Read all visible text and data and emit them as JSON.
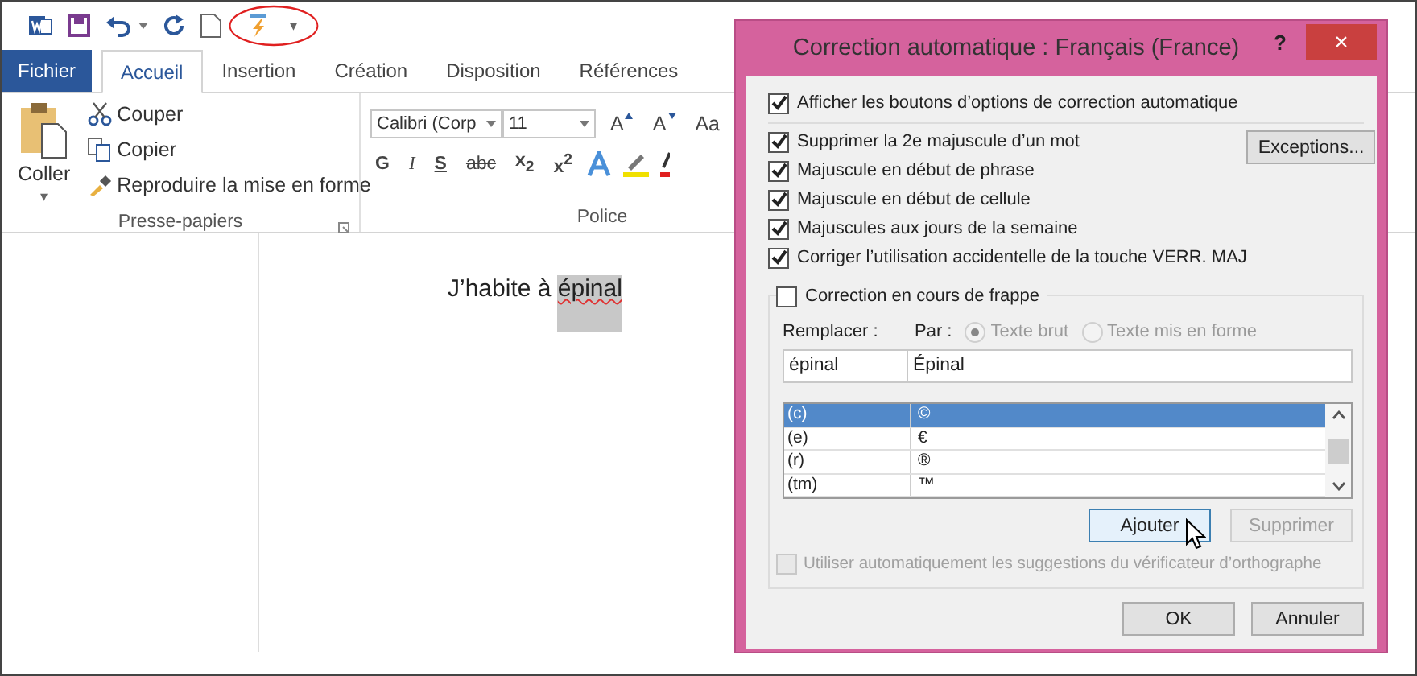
{
  "quick_access": {
    "customize": "▾"
  },
  "tabs": [
    {
      "label": "Fichier",
      "kind": "file",
      "selected": false
    },
    {
      "label": "Accueil",
      "kind": "tab",
      "selected": true
    },
    {
      "label": "Insertion",
      "kind": "tab",
      "selected": false
    },
    {
      "label": "Création",
      "kind": "tab",
      "selected": false
    },
    {
      "label": "Disposition",
      "kind": "tab",
      "selected": false
    },
    {
      "label": "Références",
      "kind": "tab",
      "selected": false
    }
  ],
  "clipboard": {
    "paste": "Coller",
    "paste_caret": "▾",
    "cut": "Couper",
    "copy": "Copier",
    "format_painter": "Reproduire la mise en forme",
    "group_label": "Presse-papiers"
  },
  "font": {
    "font_name": "Calibri (Corp",
    "size": "11",
    "grow": "A",
    "shrink": "A",
    "case": "Aa",
    "format_buttons": [
      "G",
      "I",
      "S",
      "abc",
      "x$_{2}$",
      "x$^{2}$"
    ],
    "group_label": "Police"
  },
  "document": {
    "runs": [
      {
        "text": "J’habite à ",
        "selected": false,
        "misspelled": false
      },
      {
        "text": "épinal",
        "selected": true,
        "misspelled": true
      }
    ]
  },
  "dialog": {
    "title": "Correction automatique : Français (France)",
    "help": "?",
    "close": "×",
    "show_buttons": {
      "label": "Afficher les boutons d’options de correction automatique",
      "checked": true
    },
    "options": [
      {
        "label": "Supprimer la 2e majuscule d’un mot",
        "checked": true
      },
      {
        "label": "Majuscule en début de phrase",
        "checked": true
      },
      {
        "label": "Majuscule en début de cellule",
        "checked": true
      },
      {
        "label": "Majuscules aux jours de la semaine",
        "checked": true
      },
      {
        "label": "Corriger l’utilisation accidentelle de la touche VERR. MAJ",
        "checked": true
      }
    ],
    "exceptions": "Exceptions...",
    "replace_as_you_type": {
      "label": "Correction en cours de frappe",
      "checked": false
    },
    "replace_label": "Remplacer :",
    "with_label": "Par :",
    "format_radios": [
      {
        "label": "Texte brut",
        "selected": true,
        "disabled": true
      },
      {
        "label": "Texte mis en forme",
        "selected": false,
        "disabled": true
      }
    ],
    "replace_value": "épinal",
    "with_value": "Épinal",
    "entries": [
      {
        "from": "(c)",
        "to": "©",
        "selected": true
      },
      {
        "from": "(e)",
        "to": "€",
        "selected": false
      },
      {
        "from": "(r)",
        "to": "®",
        "selected": false
      },
      {
        "from": "(tm)",
        "to": "™",
        "selected": false
      }
    ],
    "add": {
      "label": "Ajouter",
      "disabled": false
    },
    "delete": {
      "label": "Supprimer",
      "disabled": true
    },
    "auto_suggest": {
      "label": "Utiliser automatiquement les suggestions du vérificateur d’orthographe",
      "checked": false,
      "disabled": true
    },
    "ok": "OK",
    "cancel": "Annuler"
  }
}
